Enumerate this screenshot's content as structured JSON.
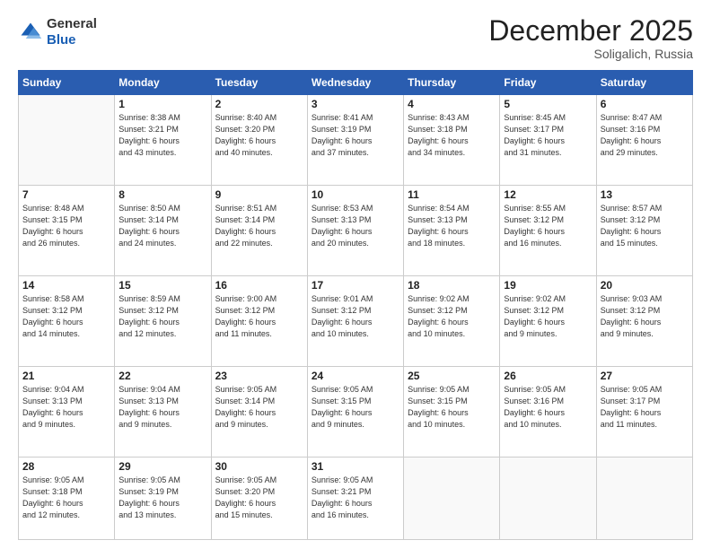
{
  "logo": {
    "general": "General",
    "blue": "Blue"
  },
  "header": {
    "month_year": "December 2025",
    "location": "Soligalich, Russia"
  },
  "weekdays": [
    "Sunday",
    "Monday",
    "Tuesday",
    "Wednesday",
    "Thursday",
    "Friday",
    "Saturday"
  ],
  "weeks": [
    [
      {
        "day": "",
        "info": ""
      },
      {
        "day": "1",
        "info": "Sunrise: 8:38 AM\nSunset: 3:21 PM\nDaylight: 6 hours\nand 43 minutes."
      },
      {
        "day": "2",
        "info": "Sunrise: 8:40 AM\nSunset: 3:20 PM\nDaylight: 6 hours\nand 40 minutes."
      },
      {
        "day": "3",
        "info": "Sunrise: 8:41 AM\nSunset: 3:19 PM\nDaylight: 6 hours\nand 37 minutes."
      },
      {
        "day": "4",
        "info": "Sunrise: 8:43 AM\nSunset: 3:18 PM\nDaylight: 6 hours\nand 34 minutes."
      },
      {
        "day": "5",
        "info": "Sunrise: 8:45 AM\nSunset: 3:17 PM\nDaylight: 6 hours\nand 31 minutes."
      },
      {
        "day": "6",
        "info": "Sunrise: 8:47 AM\nSunset: 3:16 PM\nDaylight: 6 hours\nand 29 minutes."
      }
    ],
    [
      {
        "day": "7",
        "info": "Sunrise: 8:48 AM\nSunset: 3:15 PM\nDaylight: 6 hours\nand 26 minutes."
      },
      {
        "day": "8",
        "info": "Sunrise: 8:50 AM\nSunset: 3:14 PM\nDaylight: 6 hours\nand 24 minutes."
      },
      {
        "day": "9",
        "info": "Sunrise: 8:51 AM\nSunset: 3:14 PM\nDaylight: 6 hours\nand 22 minutes."
      },
      {
        "day": "10",
        "info": "Sunrise: 8:53 AM\nSunset: 3:13 PM\nDaylight: 6 hours\nand 20 minutes."
      },
      {
        "day": "11",
        "info": "Sunrise: 8:54 AM\nSunset: 3:13 PM\nDaylight: 6 hours\nand 18 minutes."
      },
      {
        "day": "12",
        "info": "Sunrise: 8:55 AM\nSunset: 3:12 PM\nDaylight: 6 hours\nand 16 minutes."
      },
      {
        "day": "13",
        "info": "Sunrise: 8:57 AM\nSunset: 3:12 PM\nDaylight: 6 hours\nand 15 minutes."
      }
    ],
    [
      {
        "day": "14",
        "info": "Sunrise: 8:58 AM\nSunset: 3:12 PM\nDaylight: 6 hours\nand 14 minutes."
      },
      {
        "day": "15",
        "info": "Sunrise: 8:59 AM\nSunset: 3:12 PM\nDaylight: 6 hours\nand 12 minutes."
      },
      {
        "day": "16",
        "info": "Sunrise: 9:00 AM\nSunset: 3:12 PM\nDaylight: 6 hours\nand 11 minutes."
      },
      {
        "day": "17",
        "info": "Sunrise: 9:01 AM\nSunset: 3:12 PM\nDaylight: 6 hours\nand 10 minutes."
      },
      {
        "day": "18",
        "info": "Sunrise: 9:02 AM\nSunset: 3:12 PM\nDaylight: 6 hours\nand 10 minutes."
      },
      {
        "day": "19",
        "info": "Sunrise: 9:02 AM\nSunset: 3:12 PM\nDaylight: 6 hours\nand 9 minutes."
      },
      {
        "day": "20",
        "info": "Sunrise: 9:03 AM\nSunset: 3:12 PM\nDaylight: 6 hours\nand 9 minutes."
      }
    ],
    [
      {
        "day": "21",
        "info": "Sunrise: 9:04 AM\nSunset: 3:13 PM\nDaylight: 6 hours\nand 9 minutes."
      },
      {
        "day": "22",
        "info": "Sunrise: 9:04 AM\nSunset: 3:13 PM\nDaylight: 6 hours\nand 9 minutes."
      },
      {
        "day": "23",
        "info": "Sunrise: 9:05 AM\nSunset: 3:14 PM\nDaylight: 6 hours\nand 9 minutes."
      },
      {
        "day": "24",
        "info": "Sunrise: 9:05 AM\nSunset: 3:15 PM\nDaylight: 6 hours\nand 9 minutes."
      },
      {
        "day": "25",
        "info": "Sunrise: 9:05 AM\nSunset: 3:15 PM\nDaylight: 6 hours\nand 10 minutes."
      },
      {
        "day": "26",
        "info": "Sunrise: 9:05 AM\nSunset: 3:16 PM\nDaylight: 6 hours\nand 10 minutes."
      },
      {
        "day": "27",
        "info": "Sunrise: 9:05 AM\nSunset: 3:17 PM\nDaylight: 6 hours\nand 11 minutes."
      }
    ],
    [
      {
        "day": "28",
        "info": "Sunrise: 9:05 AM\nSunset: 3:18 PM\nDaylight: 6 hours\nand 12 minutes."
      },
      {
        "day": "29",
        "info": "Sunrise: 9:05 AM\nSunset: 3:19 PM\nDaylight: 6 hours\nand 13 minutes."
      },
      {
        "day": "30",
        "info": "Sunrise: 9:05 AM\nSunset: 3:20 PM\nDaylight: 6 hours\nand 15 minutes."
      },
      {
        "day": "31",
        "info": "Sunrise: 9:05 AM\nSunset: 3:21 PM\nDaylight: 6 hours\nand 16 minutes."
      },
      {
        "day": "",
        "info": ""
      },
      {
        "day": "",
        "info": ""
      },
      {
        "day": "",
        "info": ""
      }
    ]
  ]
}
